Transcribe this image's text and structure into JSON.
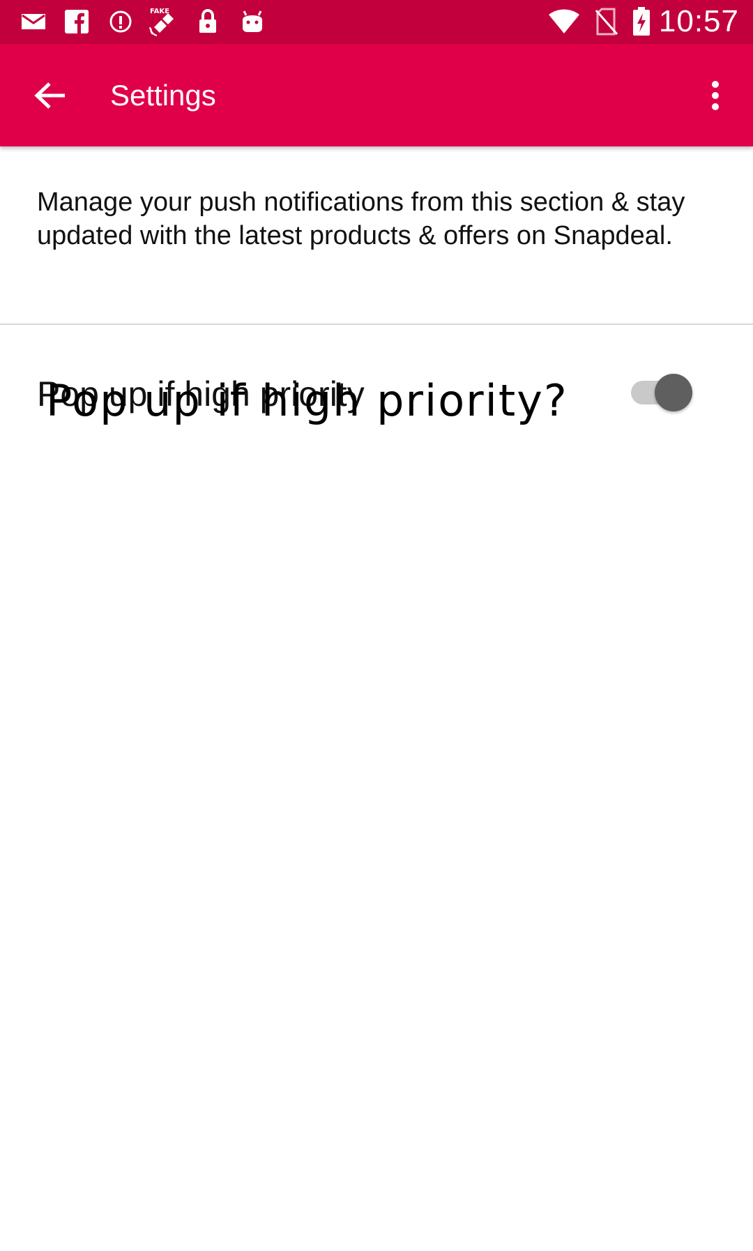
{
  "status_bar": {
    "time": "10:57",
    "left_icons": [
      "mail-icon",
      "facebook-icon",
      "info-icon",
      "fake-gps-icon",
      "lock-icon",
      "android-icon"
    ],
    "right_icons": [
      "wifi-icon",
      "no-sim-icon",
      "battery-charging-icon"
    ],
    "fake_gps_label": "FAKE"
  },
  "app_bar": {
    "title": "Settings",
    "color": "#e0004a"
  },
  "main": {
    "description": "Manage your push notifications from this section & stay updated with the latest products & offers on Snapdeal.",
    "preference": {
      "label": "Pop up if high priority",
      "overlay_label": "Pop up if high priority?",
      "toggle_on": true
    }
  }
}
